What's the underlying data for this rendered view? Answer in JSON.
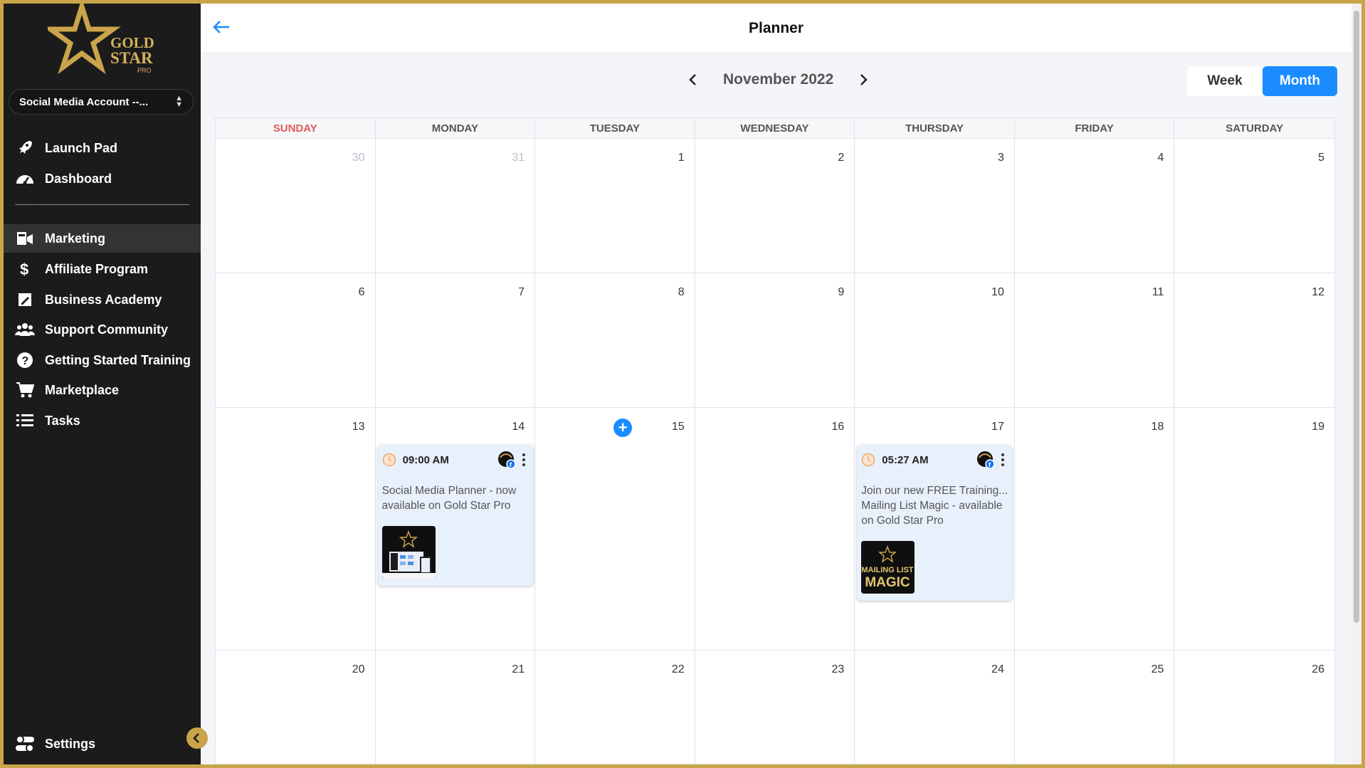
{
  "sidebar": {
    "logo_text": "GOLD STAR PRO",
    "account_select": "Social Media Account --...",
    "items": [
      {
        "label": "Launch Pad",
        "icon": "rocket-icon"
      },
      {
        "label": "Dashboard",
        "icon": "gauge-icon"
      },
      {
        "label": "Marketing",
        "icon": "megaphone-icon",
        "active": true
      },
      {
        "label": "Affiliate Program",
        "icon": "dollar-icon"
      },
      {
        "label": "Business Academy",
        "icon": "book-icon"
      },
      {
        "label": "Support Community",
        "icon": "users-icon"
      },
      {
        "label": "Getting Started Training",
        "icon": "question-icon"
      },
      {
        "label": "Marketplace",
        "icon": "cart-icon"
      },
      {
        "label": "Tasks",
        "icon": "list-icon"
      }
    ],
    "settings_label": "Settings"
  },
  "header": {
    "title": "Planner"
  },
  "calendar": {
    "month_label": "November 2022",
    "view_options": [
      "Week",
      "Month"
    ],
    "selected_view": "Month",
    "day_names": [
      "SUNDAY",
      "MONDAY",
      "TUESDAY",
      "WEDNESDAY",
      "THURSDAY",
      "FRIDAY",
      "SATURDAY"
    ],
    "weeks": [
      [
        "30",
        "31",
        "1",
        "2",
        "3",
        "4",
        "5"
      ],
      [
        "6",
        "7",
        "8",
        "9",
        "10",
        "11",
        "12"
      ],
      [
        "13",
        "14",
        "15",
        "16",
        "17",
        "18",
        "19"
      ],
      [
        "20",
        "21",
        "22",
        "23",
        "24",
        "25",
        "26"
      ]
    ],
    "posts": [
      {
        "date": "14",
        "time": "09:00 AM",
        "text": "Social Media Planner - now available on Gold Star Pro",
        "thumb": "planner-screenshot"
      },
      {
        "date": "17",
        "time": "05:27 AM",
        "text": "Join our new FREE Training... Mailing List Magic - available on Gold Star Pro",
        "thumb": "MAILING LIST MAGIC"
      }
    ]
  },
  "colors": {
    "accent": "#1a8cff",
    "gold": "#c9a44a",
    "sidebar_bg": "#1c1c1c",
    "sunday": "#e05a5a"
  }
}
